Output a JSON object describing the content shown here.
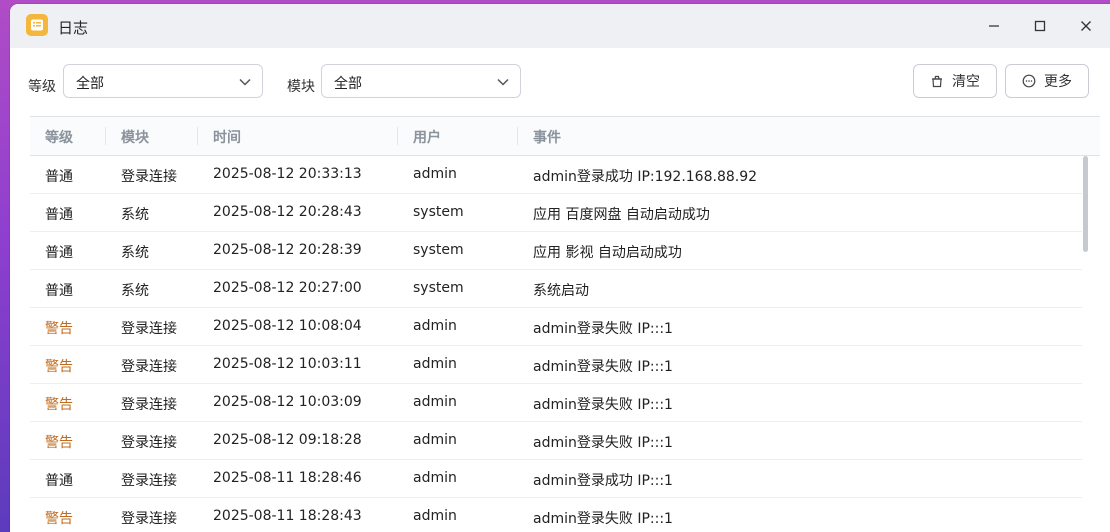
{
  "window": {
    "title": "日志"
  },
  "filters": {
    "level_label": "等级",
    "level_value": "全部",
    "module_label": "模块",
    "module_value": "全部",
    "clear_label": "清空",
    "more_label": "更多"
  },
  "table": {
    "headers": [
      "等级",
      "模块",
      "时间",
      "用户",
      "事件"
    ],
    "rows": [
      {
        "level": "普通",
        "level_type": "normal",
        "module": "登录连接",
        "time": "2025-08-12 20:33:13",
        "user": "admin",
        "event": "admin登录成功 IP:192.168.88.92"
      },
      {
        "level": "普通",
        "level_type": "normal",
        "module": "系统",
        "time": "2025-08-12 20:28:43",
        "user": "system",
        "event": "应用 百度网盘 自动启动成功"
      },
      {
        "level": "普通",
        "level_type": "normal",
        "module": "系统",
        "time": "2025-08-12 20:28:39",
        "user": "system",
        "event": "应用 影视 自动启动成功"
      },
      {
        "level": "普通",
        "level_type": "normal",
        "module": "系统",
        "time": "2025-08-12 20:27:00",
        "user": "system",
        "event": "系统启动"
      },
      {
        "level": "警告",
        "level_type": "warn",
        "module": "登录连接",
        "time": "2025-08-12 10:08:04",
        "user": "admin",
        "event": "admin登录失败 IP:::1"
      },
      {
        "level": "警告",
        "level_type": "warn",
        "module": "登录连接",
        "time": "2025-08-12 10:03:11",
        "user": "admin",
        "event": "admin登录失败 IP:::1"
      },
      {
        "level": "警告",
        "level_type": "warn",
        "module": "登录连接",
        "time": "2025-08-12 10:03:09",
        "user": "admin",
        "event": "admin登录失败 IP:::1"
      },
      {
        "level": "警告",
        "level_type": "warn",
        "module": "登录连接",
        "time": "2025-08-12 09:18:28",
        "user": "admin",
        "event": "admin登录失败 IP:::1"
      },
      {
        "level": "普通",
        "level_type": "normal",
        "module": "登录连接",
        "time": "2025-08-11 18:28:46",
        "user": "admin",
        "event": "admin登录成功 IP:::1"
      },
      {
        "level": "警告",
        "level_type": "warn",
        "module": "登录连接",
        "time": "2025-08-11 18:28:43",
        "user": "admin",
        "event": "admin登录失败 IP:::1"
      }
    ]
  },
  "colors": {
    "warn": "#c06c20",
    "normal": "#222222",
    "app_icon": "#f4b63b"
  },
  "icons": [
    "log-app-icon",
    "minimize-icon",
    "maximize-icon",
    "close-icon",
    "chevron-down-icon",
    "trash-icon",
    "more-circle-icon"
  ]
}
